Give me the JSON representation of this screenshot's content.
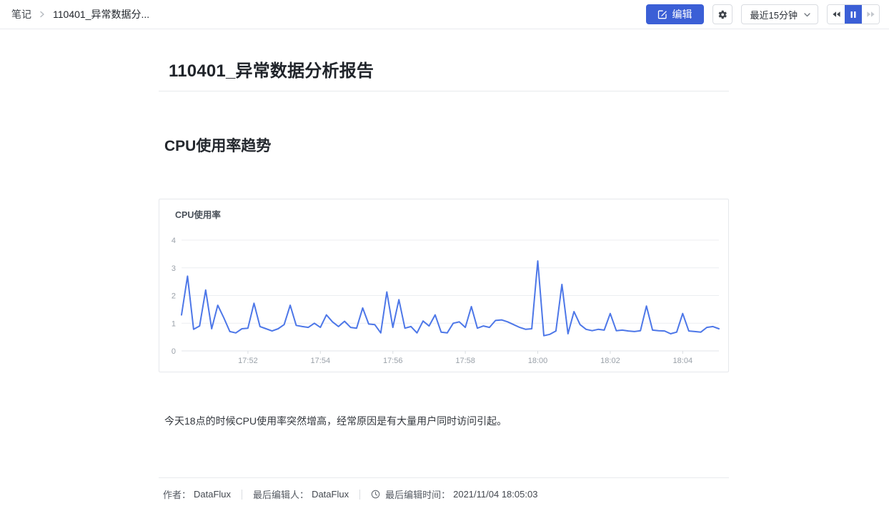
{
  "topbar": {
    "breadcrumb": {
      "root": "笔记",
      "current": "110401_异常数据分..."
    },
    "edit_label": "编辑",
    "time_range_value": "最近15分钟",
    "icons": {
      "breadcrumb_separator": "chevron-right",
      "edit": "pencil-square",
      "settings": "gear",
      "time_range": "chevron-down",
      "rewind": "double-chevron-left",
      "pause": "pause",
      "fast_forward": "double-chevron-right"
    }
  },
  "document": {
    "title": "110401_异常数据分析报告",
    "section_heading": "CPU使用率趋势",
    "paragraph": "今天18点的时候CPU使用率突然增高，经常原因是有大量用户同时访问引起。"
  },
  "chart_data": {
    "type": "line",
    "title": "CPU使用率",
    "xlabel": "",
    "ylabel": "",
    "ylim": [
      0,
      4
    ],
    "y_ticks": [
      0,
      1,
      2,
      3,
      4
    ],
    "x_ticks": [
      {
        "label": "17:52",
        "frac": 0.1236
      },
      {
        "label": "17:54",
        "frac": 0.2584
      },
      {
        "label": "17:56",
        "frac": 0.3933
      },
      {
        "label": "17:58",
        "frac": 0.5281
      },
      {
        "label": "18:00",
        "frac": 0.6629
      },
      {
        "label": "18:02",
        "frac": 0.7978
      },
      {
        "label": "18:04",
        "frac": 0.9326
      }
    ],
    "x_start": "17:50:10",
    "x_end": "18:05:00",
    "interval_seconds": 10,
    "grid": true,
    "legend_position": "none",
    "series": [
      {
        "name": "CPU使用率",
        "color": "#4d77e8",
        "values": [
          1.3,
          2.7,
          0.78,
          0.9,
          2.2,
          0.8,
          1.65,
          1.2,
          0.7,
          0.65,
          0.8,
          0.82,
          1.72,
          0.88,
          0.8,
          0.72,
          0.8,
          0.95,
          1.65,
          0.92,
          0.88,
          0.85,
          1.0,
          0.85,
          1.3,
          1.05,
          0.88,
          1.07,
          0.85,
          0.82,
          1.55,
          0.97,
          0.95,
          0.65,
          2.13,
          0.85,
          1.85,
          0.82,
          0.88,
          0.65,
          1.08,
          0.9,
          1.3,
          0.68,
          0.65,
          1.0,
          1.05,
          0.85,
          1.6,
          0.82,
          0.9,
          0.85,
          1.1,
          1.12,
          1.05,
          0.95,
          0.85,
          0.78,
          0.8,
          3.25,
          0.55,
          0.6,
          0.72,
          2.4,
          0.62,
          1.42,
          0.95,
          0.78,
          0.73,
          0.78,
          0.75,
          1.35,
          0.73,
          0.75,
          0.72,
          0.7,
          0.73,
          1.62,
          0.75,
          0.73,
          0.72,
          0.62,
          0.68,
          1.35,
          0.72,
          0.7,
          0.68,
          0.85,
          0.88,
          0.8
        ]
      }
    ]
  },
  "footer": {
    "author_label": "作者：",
    "author": "DataFlux",
    "editor_label": "最后编辑人：",
    "editor": "DataFlux",
    "time_label": "最后编辑时间：",
    "time": "2021/11/04 18:05:03"
  },
  "colors": {
    "accent_blue": "#3b5fd6",
    "chart_line": "#4d77e8",
    "border": "#e8eaed",
    "grid_line": "#eceef1",
    "text_primary": "#20242a",
    "text_secondary": "#4b5058",
    "axis_label": "#9aa1a9"
  }
}
